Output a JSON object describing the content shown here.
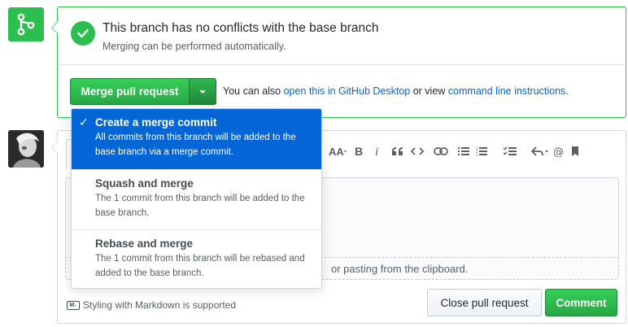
{
  "merge_status": {
    "title": "This branch has no conflicts with the base branch",
    "subtitle": "Merging can be performed automatically."
  },
  "merge_actions": {
    "merge_button_label": "Merge pull request",
    "also_prefix": "You can also ",
    "desktop_link": "open this in GitHub Desktop",
    "or_view": " or view ",
    "cli_link": "command line instructions",
    "suffix": "."
  },
  "merge_menu": {
    "items": [
      {
        "title": "Create a merge commit",
        "description": "All commits from this branch will be added to the base branch via a merge commit.",
        "selected": true
      },
      {
        "title": "Squash and merge",
        "description": "The 1 commit from this branch will be added to the base branch.",
        "selected": false
      },
      {
        "title": "Rebase and merge",
        "description": "The 1 commit from this branch will be rebased and added to the base branch.",
        "selected": false
      }
    ]
  },
  "comment": {
    "drop_hint": "or pasting from the clipboard.",
    "markdown_note": "Styling with Markdown is supported",
    "markdown_badge": "M↓",
    "close_label": "Close pull request",
    "comment_label": "Comment"
  },
  "toolbar": {
    "icons": [
      "header-icon",
      "bold-icon",
      "italic-icon",
      "quote-icon",
      "code-icon",
      "link-icon",
      "unordered-list-icon",
      "ordered-list-icon",
      "task-list-icon",
      "reply-icon",
      "mention-icon",
      "bookmark-icon"
    ]
  },
  "colors": {
    "green": "#2cbe4e",
    "blue": "#0366d6",
    "border": "#d1d5da"
  }
}
